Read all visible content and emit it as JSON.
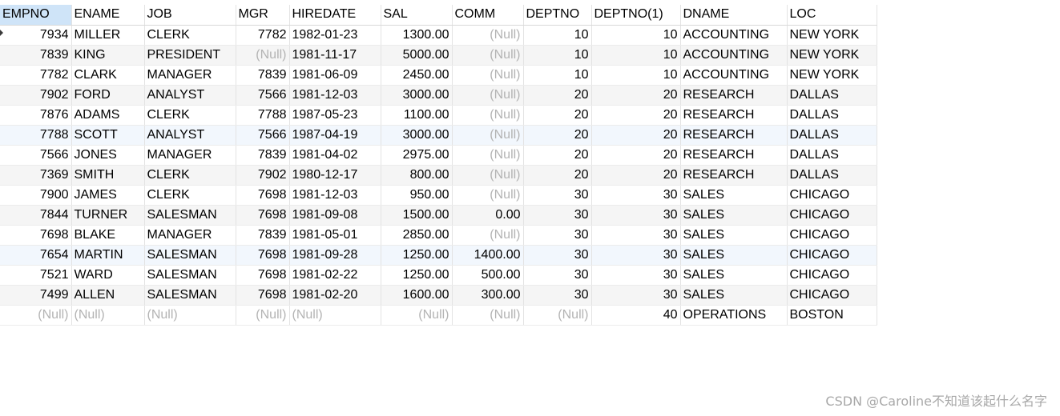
{
  "columns": [
    {
      "label": "EMPNO",
      "align": "right"
    },
    {
      "label": "ENAME",
      "align": "left"
    },
    {
      "label": "JOB",
      "align": "left"
    },
    {
      "label": "MGR",
      "align": "right"
    },
    {
      "label": "HIREDATE",
      "align": "left"
    },
    {
      "label": "SAL",
      "align": "right"
    },
    {
      "label": "COMM",
      "align": "right"
    },
    {
      "label": "DEPTNO",
      "align": "right"
    },
    {
      "label": "DEPTNO(1)",
      "align": "right"
    },
    {
      "label": "DNAME",
      "align": "left"
    },
    {
      "label": "LOC",
      "align": "left"
    }
  ],
  "rows": [
    [
      "7934",
      "MILLER",
      "CLERK",
      "7782",
      "1982-01-23",
      "1300.00",
      "(Null)",
      "10",
      "10",
      "ACCOUNTING",
      "NEW YORK"
    ],
    [
      "7839",
      "KING",
      "PRESIDENT",
      "(Null)",
      "1981-11-17",
      "5000.00",
      "(Null)",
      "10",
      "10",
      "ACCOUNTING",
      "NEW YORK"
    ],
    [
      "7782",
      "CLARK",
      "MANAGER",
      "7839",
      "1981-06-09",
      "2450.00",
      "(Null)",
      "10",
      "10",
      "ACCOUNTING",
      "NEW YORK"
    ],
    [
      "7902",
      "FORD",
      "ANALYST",
      "7566",
      "1981-12-03",
      "3000.00",
      "(Null)",
      "20",
      "20",
      "RESEARCH",
      "DALLAS"
    ],
    [
      "7876",
      "ADAMS",
      "CLERK",
      "7788",
      "1987-05-23",
      "1100.00",
      "(Null)",
      "20",
      "20",
      "RESEARCH",
      "DALLAS"
    ],
    [
      "7788",
      "SCOTT",
      "ANALYST",
      "7566",
      "1987-04-19",
      "3000.00",
      "(Null)",
      "20",
      "20",
      "RESEARCH",
      "DALLAS"
    ],
    [
      "7566",
      "JONES",
      "MANAGER",
      "7839",
      "1981-04-02",
      "2975.00",
      "(Null)",
      "20",
      "20",
      "RESEARCH",
      "DALLAS"
    ],
    [
      "7369",
      "SMITH",
      "CLERK",
      "7902",
      "1980-12-17",
      "800.00",
      "(Null)",
      "20",
      "20",
      "RESEARCH",
      "DALLAS"
    ],
    [
      "7900",
      "JAMES",
      "CLERK",
      "7698",
      "1981-12-03",
      "950.00",
      "(Null)",
      "30",
      "30",
      "SALES",
      "CHICAGO"
    ],
    [
      "7844",
      "TURNER",
      "SALESMAN",
      "7698",
      "1981-09-08",
      "1500.00",
      "0.00",
      "30",
      "30",
      "SALES",
      "CHICAGO"
    ],
    [
      "7698",
      "BLAKE",
      "MANAGER",
      "7839",
      "1981-05-01",
      "2850.00",
      "(Null)",
      "30",
      "30",
      "SALES",
      "CHICAGO"
    ],
    [
      "7654",
      "MARTIN",
      "SALESMAN",
      "7698",
      "1981-09-28",
      "1250.00",
      "1400.00",
      "30",
      "30",
      "SALES",
      "CHICAGO"
    ],
    [
      "7521",
      "WARD",
      "SALESMAN",
      "7698",
      "1981-02-22",
      "1250.00",
      "500.00",
      "30",
      "30",
      "SALES",
      "CHICAGO"
    ],
    [
      "7499",
      "ALLEN",
      "SALESMAN",
      "7698",
      "1981-02-20",
      "1600.00",
      "300.00",
      "30",
      "30",
      "SALES",
      "CHICAGO"
    ],
    [
      "(Null)",
      "(Null)",
      "(Null)",
      "(Null)",
      "(Null)",
      "(Null)",
      "(Null)",
      "(Null)",
      "40",
      "OPERATIONS",
      "BOSTON"
    ]
  ],
  "highlighted_rows": [
    5,
    11
  ],
  "current_row_indicator_icon": "triangle-right-icon",
  "watermark": "CSDN @Caroline不知道该起什么名字"
}
